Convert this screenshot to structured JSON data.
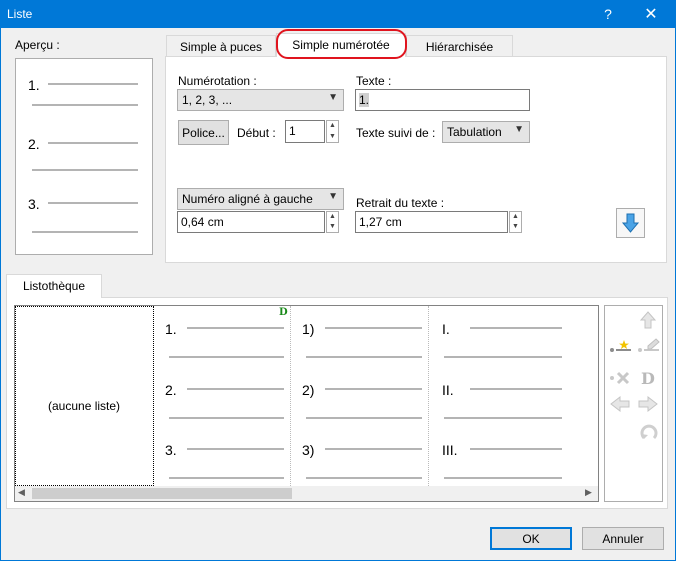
{
  "window": {
    "title": "Liste",
    "help": "?",
    "close": "✕"
  },
  "preview": {
    "label": "Aperçu :",
    "items": [
      "1.",
      "2.",
      "3."
    ]
  },
  "tabs": [
    {
      "label": "Simple à puces"
    },
    {
      "label": "Simple numérotée"
    },
    {
      "label": "Hiérarchisée"
    }
  ],
  "numbering": {
    "label": "Numérotation :",
    "value": "1, 2, 3, ...",
    "font_button": "Police...",
    "start_label": "Début :",
    "start_value": "1",
    "alignment": "Numéro aligné à gauche",
    "indent_value": "0,64 cm"
  },
  "text": {
    "label": "Texte :",
    "value": "1.",
    "followed_label": "Texte suivi de :",
    "followed_value": "Tabulation",
    "retrait_label": "Retrait du texte :",
    "retrait_value": "1,27 cm"
  },
  "library": {
    "tab": "Listothèque",
    "none": "(aucune liste)",
    "badge": "D",
    "columns": [
      [
        "1.",
        "2.",
        "3."
      ],
      [
        "1)",
        "2)",
        "3)"
      ],
      [
        "I.",
        "II.",
        "III."
      ]
    ]
  },
  "side_tools": {
    "d_label": "D"
  },
  "buttons": {
    "ok": "OK",
    "cancel": "Annuler"
  },
  "colors": {
    "titlebar": "#0078d7",
    "highlight_ring": "#e0141e",
    "arrow_icon": "#4aa3e6",
    "badge": "#1a8a1a"
  }
}
